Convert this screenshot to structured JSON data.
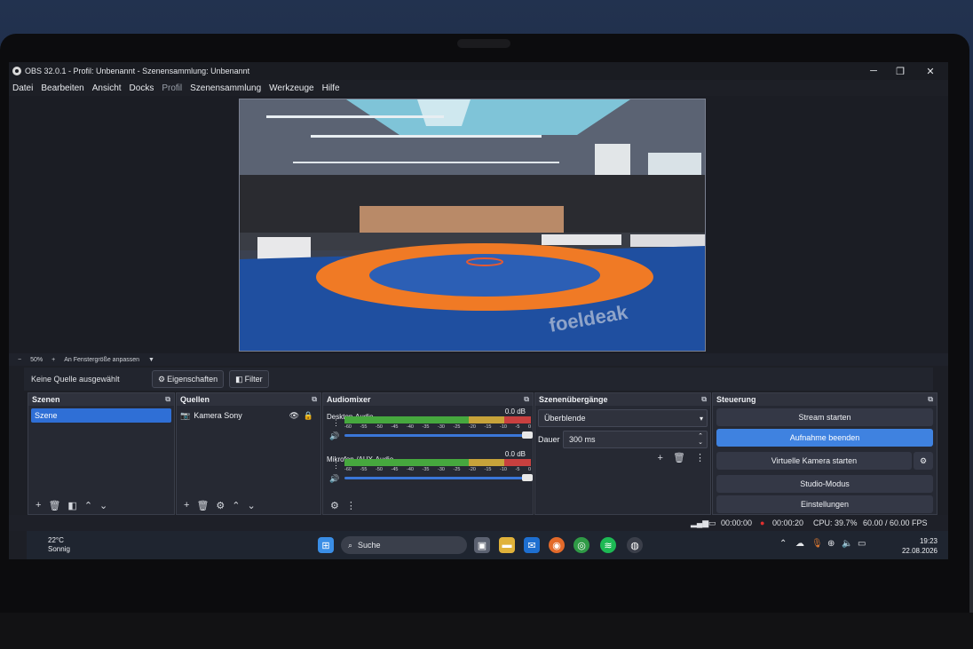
{
  "window": {
    "title": "OBS 32.0.1 - Profil: Unbenannt - Szenensammlung: Unbenannt",
    "minimize": "─",
    "maximize": "❐",
    "close": "✕"
  },
  "menu": {
    "items": [
      {
        "label": "Datei",
        "dim": false
      },
      {
        "label": "Bearbeiten",
        "dim": false
      },
      {
        "label": "Ansicht",
        "dim": false
      },
      {
        "label": "Docks",
        "dim": false
      },
      {
        "label": "Profil",
        "dim": true
      },
      {
        "label": "Szenensammlung",
        "dim": false
      },
      {
        "label": "Werkzeuge",
        "dim": false
      },
      {
        "label": "Hilfe",
        "dim": false
      }
    ]
  },
  "preview": {
    "mat_text": "foeldeak",
    "zoom_minus": "−",
    "zoom_value": "50%",
    "zoom_plus": "+",
    "fit_label": "An Fenstergröße anpassen",
    "fit_arrow": "▼"
  },
  "context_bar": {
    "no_source": "Keine Quelle ausgewählt",
    "properties": "Eigenschaften",
    "filters": "Filter"
  },
  "scenes": {
    "title": "Szenen",
    "items": [
      "Szene"
    ]
  },
  "sources": {
    "title": "Quellen",
    "items": [
      {
        "name": "Kamera Sony",
        "icon": "camera-icon",
        "visible_icon": "eye-icon",
        "lock_icon": "lock-icon"
      }
    ]
  },
  "audio_mixer": {
    "title": "Audiomixer",
    "ticks": [
      "-60",
      "-55",
      "-50",
      "-45",
      "-40",
      "-35",
      "-30",
      "-25",
      "-20",
      "-15",
      "-10",
      "-5",
      "0"
    ],
    "channels": [
      {
        "name": "Desktop-Audio",
        "db": "0.0 dB"
      },
      {
        "name": "Mikrofon-/AUX-Audio",
        "db": "0.0 dB"
      }
    ]
  },
  "transitions": {
    "title": "Szenenübergänge",
    "type": "Überblende",
    "duration_label": "Dauer",
    "duration_value": "300 ms"
  },
  "controls": {
    "title": "Steuerung",
    "stream": "Stream starten",
    "record": "Aufnahme beenden",
    "virtual_cam": "Virtuelle Kamera starten",
    "studio": "Studio-Modus",
    "settings": "Einstellungen"
  },
  "status": {
    "stream_time": "00:00:00",
    "record_time": "00:00:20",
    "cpu": "CPU: 39.7%",
    "fps": "60.00 / 60.00 FPS"
  },
  "taskbar": {
    "weather_temp": "22°C",
    "weather_desc": "Sonnig",
    "search": "Suche",
    "time": "19:23",
    "date": "22.08.2026"
  },
  "colors": {
    "accent": "#3f82e0",
    "record_red": "#e0302f"
  }
}
